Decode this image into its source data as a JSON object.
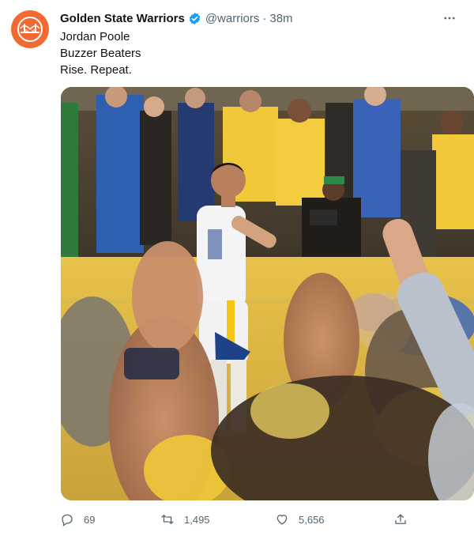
{
  "account": {
    "name": "Golden State Warriors",
    "handle": "@warriors",
    "separator": "·",
    "time": "38m"
  },
  "tweet": {
    "lines": [
      "Jordan Poole",
      "Buzzer Beaters",
      "Rise. Repeat."
    ]
  },
  "media": {
    "description_icon": "video-still"
  },
  "actions": {
    "replies": "69",
    "retweets": "1,495",
    "likes": "5,656"
  },
  "colors": {
    "avatar_bg": "#f26a32",
    "verified": "#1d9bf0",
    "secondary_text": "#536471",
    "warriors_gold": "#f5c518",
    "warriors_blue": "#1d428a"
  }
}
